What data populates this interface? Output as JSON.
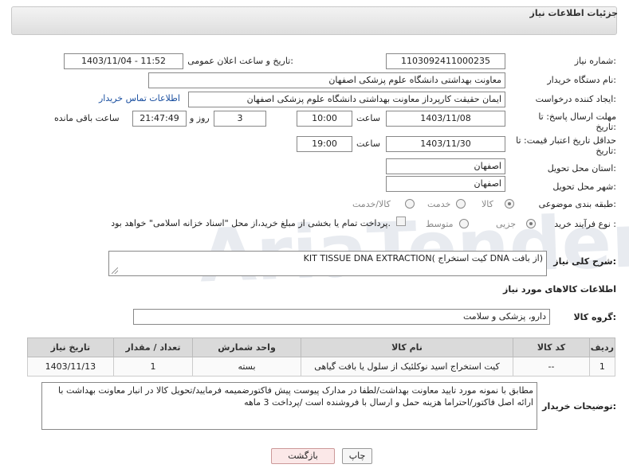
{
  "header": {
    "title": "جزئیات اطلاعات نیاز"
  },
  "fields": {
    "need_number_label": "شماره نیاز:",
    "need_number": "1103092411000235",
    "announce_label": "تاریخ و ساعت اعلان عمومی:",
    "announce_value": "1403/11/04 - 11:52",
    "buyer_org_label": "نام دستگاه خریدار:",
    "buyer_org": "معاونت بهداشتی دانشگاه علوم پزشکی اصفهان",
    "creator_label": "ایجاد کننده درخواست:",
    "creator": "ایمان حقیقت کارپرداز معاونت بهداشتی دانشگاه علوم پزشکی اصفهان",
    "contact_link": "اطلاعات تماس خریدار",
    "reply_deadline_label_1": "مهلت ارسال پاسخ: تا",
    "reply_deadline_label_2": "تاریخ:",
    "reply_date": "1403/11/08",
    "time_label": "ساعت",
    "reply_time": "10:00",
    "days_value": "3",
    "days_label": "روز و",
    "remaining_time": "21:47:49",
    "remaining_label": "ساعت باقی مانده",
    "validity_label_1": "حداقل تاریخ اعتبار قیمت: تا",
    "validity_label_2": "تاریخ:",
    "validity_date": "1403/11/30",
    "validity_time": "19:00",
    "province_label": "استان محل تحویل:",
    "province": "اصفهان",
    "city_label": "شهر محل تحویل:",
    "city": "اصفهان",
    "category_label": "طبقه بندی موضوعی:",
    "category_options": [
      "کالا",
      "خدمت",
      "کالا/خدمت"
    ],
    "process_label": "نوع فرآیند خرید :",
    "process_options": [
      "جزیی",
      "متوسط"
    ],
    "payment_note": "پرداخت تمام یا بخشی از مبلغ خرید،از محل \"اسناد خزانه اسلامی\" خواهد بود.",
    "summary_label": "شرح کلی نیاز:",
    "summary": "KIT TISSUE DNA EXTRACTION( کیت استخراج DNA از بافت)",
    "goods_info_title": "اطلاعات کالاهای مورد نیاز",
    "goods_group_label": "گروه کالا:",
    "goods_group": "دارو، پزشکی و سلامت"
  },
  "table": {
    "headers": [
      "ردیف",
      "کد کالا",
      "نام کالا",
      "واحد شمارش",
      "تعداد / مقدار",
      "تاریخ نیاز"
    ],
    "rows": [
      [
        "1",
        "--",
        "کیت استخراج اسید نوکلئیک از سلول یا بافت گیاهی",
        "بسته",
        "1",
        "1403/11/13"
      ]
    ]
  },
  "notes": {
    "label": "توضیحات خریدار:",
    "text": "مطابق با نمونه مورد تایید معاونت بهداشت/لطفا در مدارک پیوست پیش فاکتورضمیمه فرمایید/تحویل کالا در انبار معاونت بهداشت با ارائه اصل فاکتور/احتراما هزینه حمل و ارسال با فروشنده است /پرداخت 3 ماهه"
  },
  "buttons": {
    "print": "چاپ",
    "back": "بازگشت"
  },
  "watermark": "AriaTender.neT"
}
